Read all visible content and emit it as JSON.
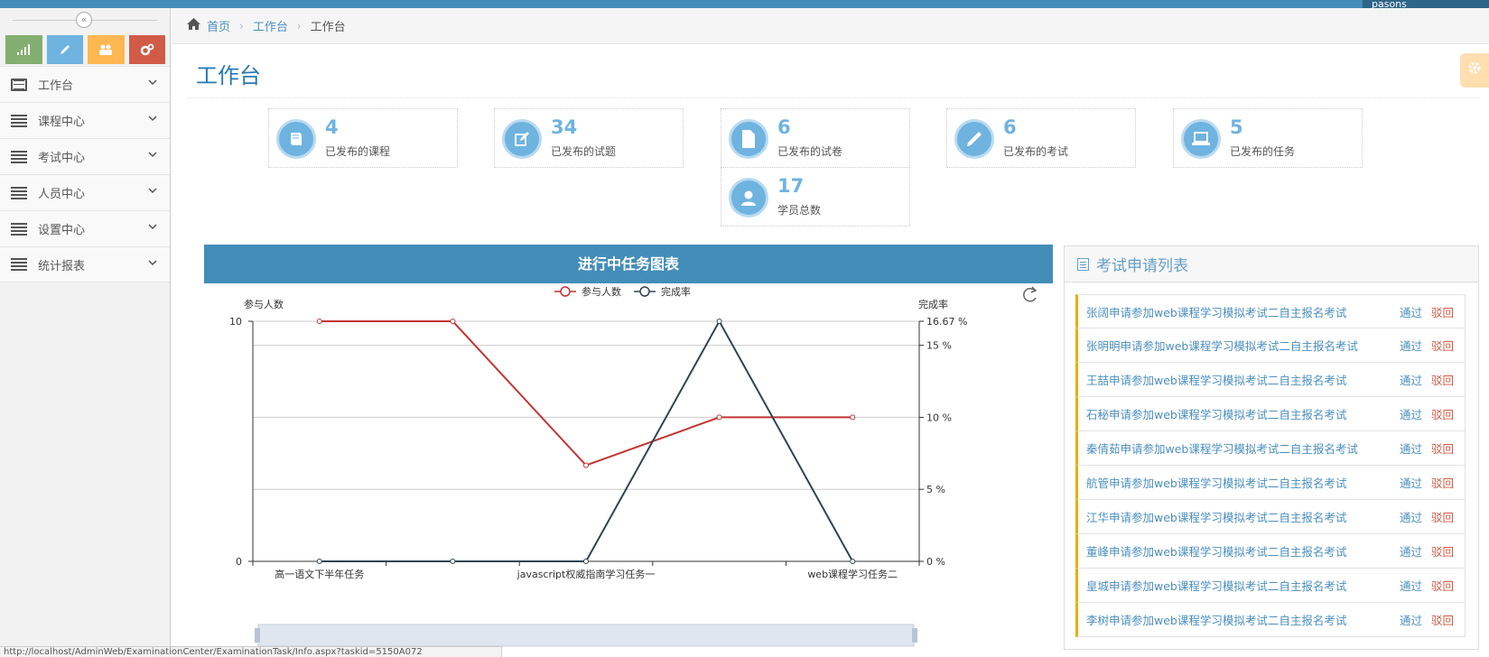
{
  "topbar": {
    "username": "pasons"
  },
  "sidebar": {
    "collapse_glyph": "«",
    "shortcuts": [
      {
        "icon": "signal-icon",
        "color": "#82af6f"
      },
      {
        "icon": "pencil-icon",
        "color": "#6fb3e0"
      },
      {
        "icon": "users-icon",
        "color": "#ffb752"
      },
      {
        "icon": "cogs-icon",
        "color": "#d15b47"
      }
    ],
    "items": [
      {
        "label": "工作台"
      },
      {
        "label": "课程中心"
      },
      {
        "label": "考试中心"
      },
      {
        "label": "人员中心"
      },
      {
        "label": "设置中心"
      },
      {
        "label": "统计报表"
      }
    ]
  },
  "breadcrumb": {
    "home": "首页",
    "level1": "工作台",
    "current": "工作台"
  },
  "page": {
    "title": "工作台"
  },
  "stats": [
    {
      "value": "4",
      "label": "已发布的课程",
      "icon": "book-icon"
    },
    {
      "value": "34",
      "label": "已发布的试题",
      "icon": "edit-icon"
    },
    {
      "value": "6",
      "label": "已发布的试卷",
      "icon": "file-icon"
    },
    {
      "value": "6",
      "label": "已发布的考试",
      "icon": "pencil-icon"
    },
    {
      "value": "5",
      "label": "已发布的任务",
      "icon": "laptop-icon"
    },
    {
      "value": "17",
      "label": "学员总数",
      "icon": "user-icon"
    }
  ],
  "chart_panel": {
    "title": "进行中任务图表"
  },
  "chart_data": {
    "type": "line",
    "categories": [
      "高一语文下半年任务",
      "",
      "javascript权威指南学习任务一",
      "",
      "web课程学习任务二"
    ],
    "series": [
      {
        "name": "参与人数",
        "values": [
          10,
          10,
          4,
          6,
          6
        ],
        "color": "#c23531",
        "axis": "left"
      },
      {
        "name": "完成率",
        "values": [
          0,
          0,
          0,
          16.67,
          0
        ],
        "color": "#2f4554",
        "axis": "right"
      }
    ],
    "ylabel_left": "参与人数",
    "ylabel_right": "完成率",
    "ylim_left": [
      0,
      10
    ],
    "ylim_right": [
      0,
      16.67
    ],
    "left_ticks": [
      "0",
      "10"
    ],
    "right_ticks": [
      "0 %",
      "5 %",
      "10 %",
      "15 %",
      "16.67 %"
    ],
    "grid": true,
    "legend": "top-center"
  },
  "apply": {
    "title": "考试申请列表",
    "pass_label": "通过",
    "reject_label": "驳回",
    "items": [
      "张阔申请参加web课程学习模拟考试二自主报名考试",
      "张明明申请参加web课程学习模拟考试二自主报名考试",
      "王喆申请参加web课程学习模拟考试二自主报名考试",
      "石秘申请参加web课程学习模拟考试二自主报名考试",
      "秦倩茹申请参加web课程学习模拟考试二自主报名考试",
      "航管申请参加web课程学习模拟考试二自主报名考试",
      "江华申请参加web课程学习模拟考试二自主报名考试",
      "董峰申请参加web课程学习模拟考试二自主报名考试",
      "皇城申请参加web课程学习模拟考试二自主报名考试",
      "李树申请参加web课程学习模拟考试二自主报名考试"
    ]
  },
  "status_bar": {
    "url": "http://localhost/AdminWeb/ExaminationCenter/ExaminationTask/Info.aspx?taskid=5150A072"
  }
}
